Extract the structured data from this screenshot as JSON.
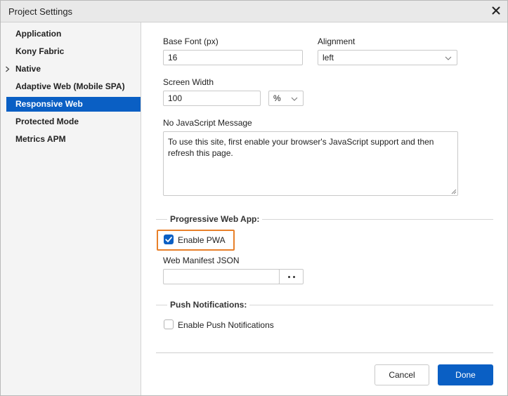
{
  "window": {
    "title": "Project Settings",
    "close_icon": "close-icon"
  },
  "sidebar": {
    "items": [
      {
        "label": "Application",
        "selected": false,
        "expandable": false
      },
      {
        "label": "Kony Fabric",
        "selected": false,
        "expandable": false
      },
      {
        "label": "Native",
        "selected": false,
        "expandable": true
      },
      {
        "label": "Adaptive Web (Mobile SPA)",
        "selected": false,
        "expandable": false
      },
      {
        "label": "Responsive Web",
        "selected": true,
        "expandable": false
      },
      {
        "label": "Protected Mode",
        "selected": false,
        "expandable": false
      },
      {
        "label": "Metrics APM",
        "selected": false,
        "expandable": false
      }
    ]
  },
  "form": {
    "base_font": {
      "label": "Base Font (px)",
      "value": "16"
    },
    "alignment": {
      "label": "Alignment",
      "value": "left"
    },
    "screen_width": {
      "label": "Screen Width",
      "value": "100",
      "unit": "%"
    },
    "no_js_message": {
      "label": "No JavaScript Message",
      "value": "To use this site, first enable your browser's JavaScript support and then refresh this page."
    },
    "pwa": {
      "section_title": "Progressive Web App:",
      "enable_label": "Enable PWA",
      "enabled": true,
      "manifest_label": "Web Manifest JSON",
      "manifest_value": ""
    },
    "push": {
      "section_title": "Push Notifications:",
      "enable_label": "Enable Push Notifications",
      "enabled": false
    }
  },
  "footer": {
    "cancel_label": "Cancel",
    "done_label": "Done"
  },
  "colors": {
    "accent": "#0a5fc4",
    "highlight": "#e8802a"
  }
}
